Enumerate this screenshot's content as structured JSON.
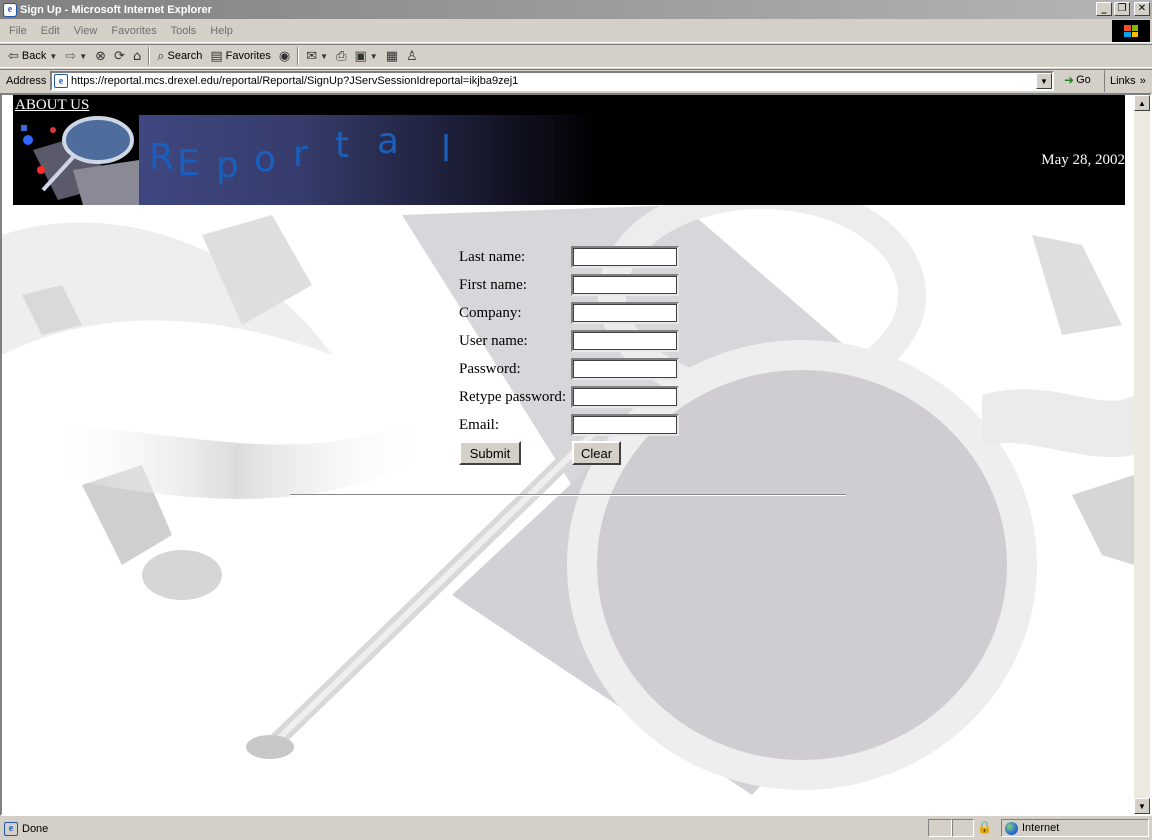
{
  "window": {
    "title": "Sign Up - Microsoft Internet Explorer",
    "buttons": [
      "_",
      "❐",
      "✕"
    ]
  },
  "menubar": {
    "items": [
      "File",
      "Edit",
      "View",
      "Favorites",
      "Tools",
      "Help"
    ]
  },
  "toolbar": {
    "back_label": "Back",
    "search_label": "Search",
    "favorites_label": "Favorites"
  },
  "addressbar": {
    "label": "Address",
    "url": "https://reportal.mcs.drexel.edu/reportal/Reportal/SignUp?JServSessionIdreportal=ikjba9zej1",
    "go_label": "Go",
    "links_label": "Links"
  },
  "page": {
    "about_link": "ABOUT US",
    "brand_letters": [
      "R",
      "E",
      "p",
      "o",
      "r",
      "t",
      "a",
      "l"
    ],
    "date": "May 28, 2002",
    "form": {
      "fields": [
        {
          "label": "Last name:",
          "value": ""
        },
        {
          "label": "First name:",
          "value": ""
        },
        {
          "label": "Company:",
          "value": ""
        },
        {
          "label": "User name:",
          "value": ""
        },
        {
          "label": "Password:",
          "value": ""
        },
        {
          "label": "Retype password:",
          "value": ""
        },
        {
          "label": "Email:",
          "value": ""
        }
      ],
      "submit_label": "Submit",
      "clear_label": "Clear"
    }
  },
  "statusbar": {
    "status": "Done",
    "zone": "Internet"
  },
  "colors": {
    "brand_text": "#1a5fbe",
    "banner_bg": "#000000",
    "chrome": "#d4d0c8"
  }
}
